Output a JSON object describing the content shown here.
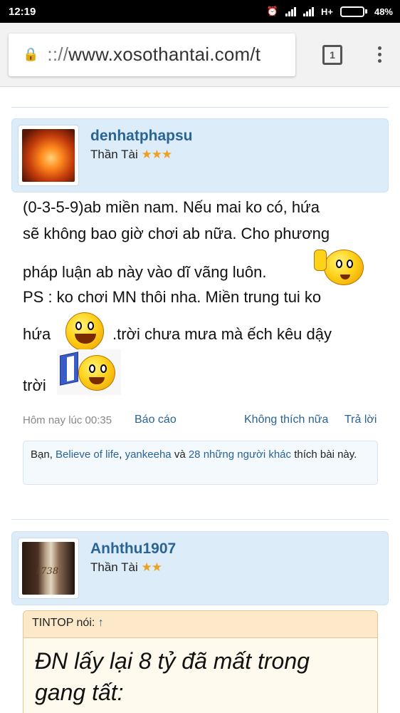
{
  "status": {
    "time": "12:19",
    "network": "H+",
    "battery": "48%"
  },
  "browser": {
    "url_scheme": ":://",
    "url_host": "www.xosothantai.com/t",
    "tab_count": "1"
  },
  "posts": [
    {
      "username": "denhatphapsu",
      "rank": "Thần Tài",
      "stars": "★★★",
      "lines": [
        "(0-3-5-9)ab miền nam. Nếu mai ko có, hứa",
        "sẽ không bao giờ chơi ab nữa. Cho phương",
        "pháp luận ab này vào dĩ vãng luôn.",
        "PS : ko chơi MN thôi nha. Miền trung tui ko",
        "hứa",
        ".trời chưa mưa mà ếch kêu dậy",
        "trời"
      ],
      "date": "Hôm nay lúc 00:35",
      "report": "Báo cáo",
      "unlike": "Không thích nữa",
      "reply": "Trả lời",
      "likes": {
        "prefix": "Bạn, ",
        "user1": "Believe of life",
        "comma": ", ",
        "user2": "yankeeha",
        "and": " và ",
        "others": "28 những người khác",
        "suffix": " thích bài này."
      }
    },
    {
      "username": "Anhthu1907",
      "rank": "Thần Tài",
      "stars": "★★",
      "quote": {
        "author": "TINTOP nói: ",
        "arrow": "↑",
        "lines": [
          "ĐN lấy lại 8 tỷ đã mất trong",
          "gang tất:"
        ]
      }
    }
  ]
}
